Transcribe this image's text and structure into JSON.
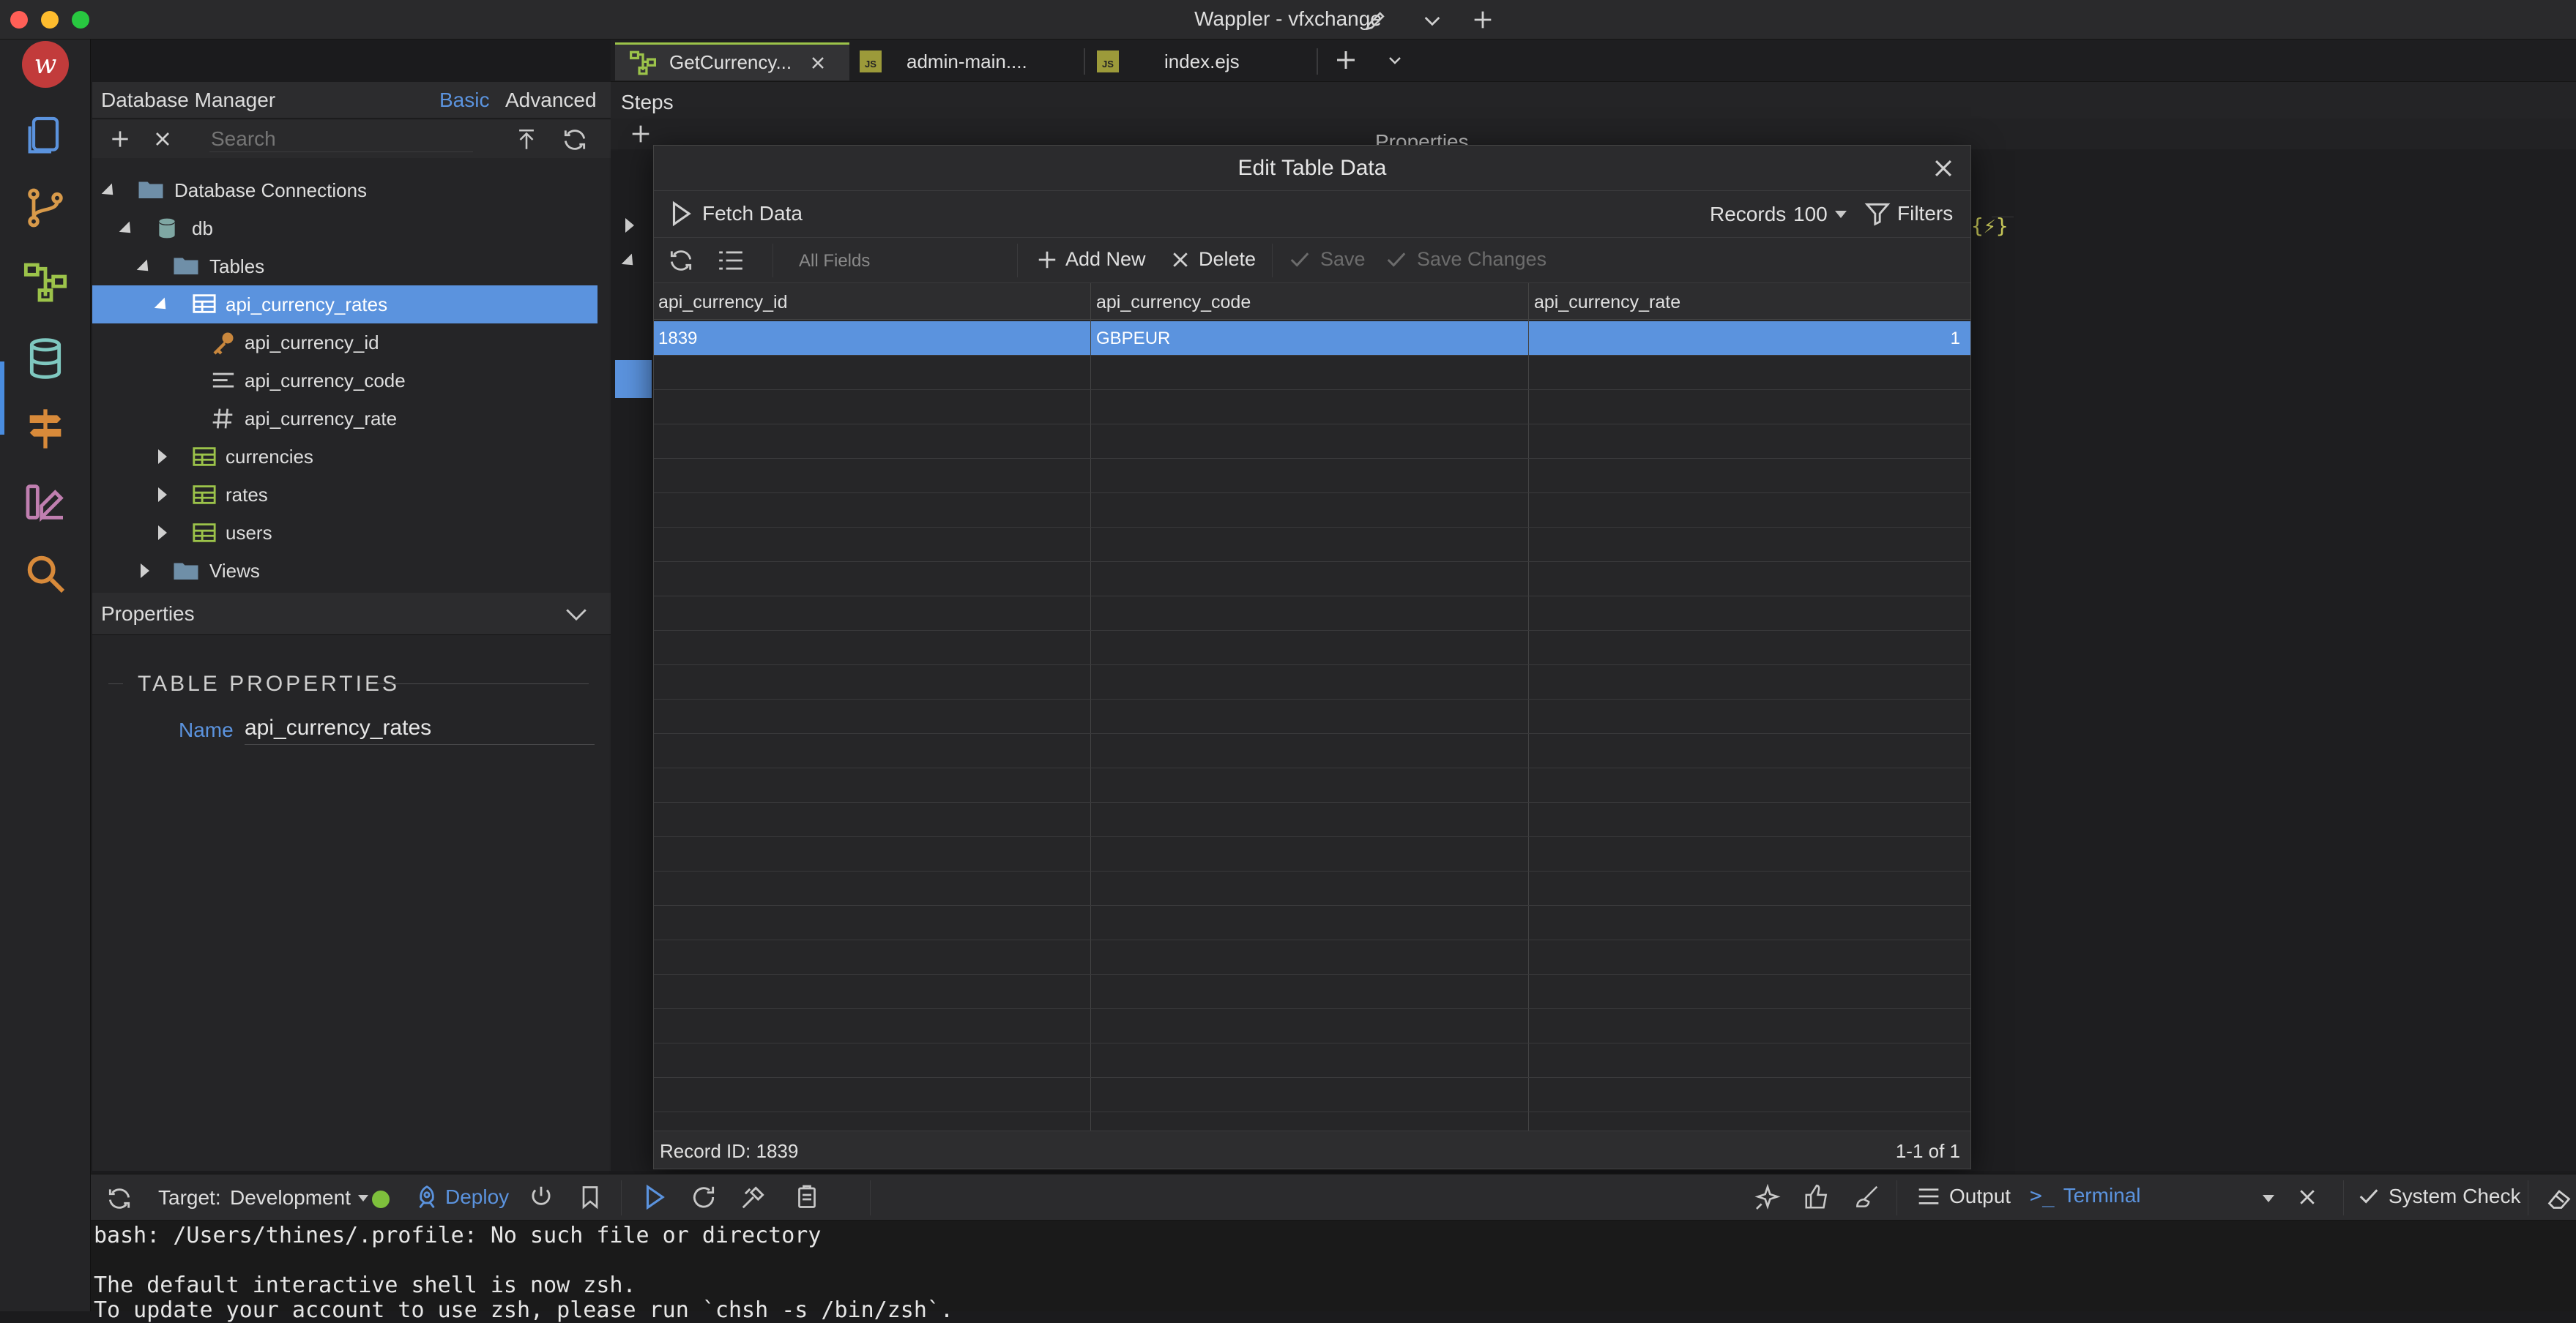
{
  "window": {
    "title": "Wappler - vfxchange"
  },
  "colors": {
    "accent": "#4a8de0",
    "selection": "#5b93de",
    "bg": "#1b1b1d",
    "success": "#2ea043"
  },
  "db_manager": {
    "title": "Database Manager",
    "mode_basic": "Basic",
    "mode_advanced": "Advanced",
    "search_placeholder": "Search",
    "tree": {
      "root": "Database Connections",
      "db": "db",
      "tables_folder": "Tables",
      "selected_table": "api_currency_rates",
      "fields": [
        "api_currency_id",
        "api_currency_code",
        "api_currency_rate"
      ],
      "other_tables": [
        "currencies",
        "rates",
        "users"
      ],
      "views_folder": "Views"
    }
  },
  "properties": {
    "header": "Properties",
    "section": "TABLE PROPERTIES",
    "name_label": "Name",
    "name_value": "api_currency_rates"
  },
  "tabs": [
    {
      "label": "GetCurrency...",
      "icon": "flow-icon",
      "active": true
    },
    {
      "label": "admin-main....",
      "icon": "js-file-icon",
      "active": false
    },
    {
      "label": "index.ejs",
      "icon": "js-file-icon",
      "active": false
    }
  ],
  "steps": {
    "label": "Steps",
    "properties_partial": "Properties"
  },
  "modal": {
    "title": "Edit Table Data",
    "fetch_label": "Fetch Data",
    "records_label": "Records",
    "records_value": "100",
    "filters_label": "Filters",
    "field_select_placeholder": "All Fields",
    "add_new_label": "Add New",
    "delete_label": "Delete",
    "save_label": "Save",
    "save_changes_label": "Save Changes",
    "columns": [
      "api_currency_id",
      "api_currency_code",
      "api_currency_rate"
    ],
    "rows": [
      {
        "id": "1839",
        "code": "GBPEUR",
        "rate": "1"
      }
    ],
    "record_id": "Record ID: 1839",
    "pagination": "1-1 of 1"
  },
  "bottom": {
    "target_label": "Target:",
    "target_value": "Development",
    "deploy_label": "Deploy",
    "output_label": "Output",
    "terminal_label": "Terminal",
    "system_check_label": "System Check"
  },
  "terminal": {
    "lines": [
      "bash: /Users/thines/.profile: No such file or directory",
      "",
      "The default interactive shell is now zsh.",
      "To update your account to use zsh, please run `chsh -s /bin/zsh`."
    ]
  }
}
